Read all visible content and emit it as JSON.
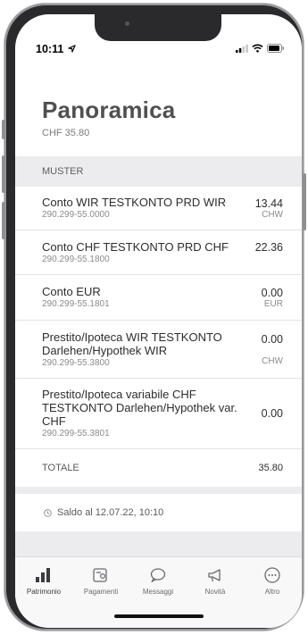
{
  "status": {
    "time": "10:11"
  },
  "header": {
    "title": "Panoramica",
    "subtitle": "CHF 35.80"
  },
  "section": {
    "label": "MUSTER"
  },
  "accounts": [
    {
      "name": "Conto WIR TESTKONTO PRD WIR",
      "iban": "290.299-55.0000",
      "amount": "13.44",
      "currency": "CHW"
    },
    {
      "name": "Conto CHF TESTKONTO PRD CHF",
      "iban": "290.299-55.1800",
      "amount": "22.36",
      "currency": ""
    },
    {
      "name": "Conto EUR",
      "iban": "290.299-55.1801",
      "amount": "0.00",
      "currency": "EUR"
    },
    {
      "name": "Prestito/Ipoteca WIR TESTKONTO Darlehen/Hypothek WIR",
      "iban": "290.299-55.3800",
      "amount": "0.00",
      "currency": "CHW"
    },
    {
      "name": "Prestito/Ipoteca variabile CHF TESTKONTO Darlehen/Hypothek var. CHF",
      "iban": "290.299-55.3801",
      "amount": "0.00",
      "currency": ""
    }
  ],
  "total": {
    "label": "TOTALE",
    "value": "35.80"
  },
  "saldo": {
    "text": "Saldo al 12.07.22, 10:10"
  },
  "tabs": [
    {
      "label": "Patrimonio",
      "icon": "bar-chart-icon"
    },
    {
      "label": "Pagamenti",
      "icon": "payment-icon"
    },
    {
      "label": "Messaggi",
      "icon": "chat-bubble-icon"
    },
    {
      "label": "Novità",
      "icon": "megaphone-icon"
    },
    {
      "label": "Altro",
      "icon": "more-icon"
    }
  ]
}
